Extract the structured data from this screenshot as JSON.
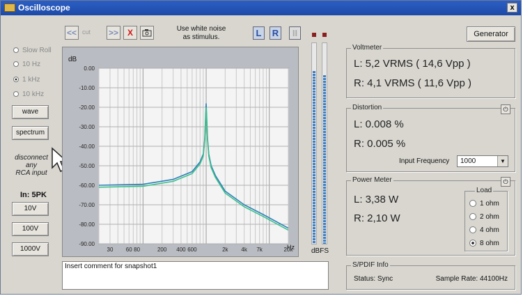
{
  "window": {
    "title": "Oscilloscope",
    "close_label": "x"
  },
  "toolbar": {
    "nav_prev": "<<",
    "nav_mid": "cut",
    "nav_next": ">>",
    "delete": "X",
    "stimulus_text_1": "Use white noise",
    "stimulus_text_2": "as stimulus.",
    "left_label": "L",
    "right_label": "R",
    "pause_label": "II",
    "generator_label": "Generator"
  },
  "left_panel": {
    "radios": [
      {
        "label": "Slow Roll",
        "selected": false
      },
      {
        "label": "10 Hz",
        "selected": false
      },
      {
        "label": "1 kHz",
        "selected": true
      },
      {
        "label": "10 kHz",
        "selected": false
      }
    ],
    "wave_label": "wave",
    "spectrum_label": "spectrum",
    "disconnect_1": "disconnect",
    "disconnect_2": "any",
    "disconnect_3": "RCA input",
    "in_label": "In: 5PK",
    "range_buttons": [
      "10V",
      "100V",
      "1000V"
    ]
  },
  "chart_data": {
    "type": "line",
    "ylabel": "dB",
    "xlabel": "Hz",
    "y_ticks": [
      "0.00",
      "-10.00",
      "-20.00",
      "-30.00",
      "-40.00",
      "-50.00",
      "-60.00",
      "-70.00",
      "-80.00",
      "-90.00"
    ],
    "x_ticks": [
      "30",
      "60",
      "80",
      "200",
      "400",
      "600",
      "2k",
      "4k",
      "7k",
      "20k"
    ],
    "ylim": [
      -90,
      0
    ],
    "xlim": [
      20,
      20000
    ],
    "log_x": true,
    "grid": true,
    "colors": {
      "left": "#2f7fb8",
      "right": "#3cc08a"
    },
    "series": [
      {
        "color": "#2f7fb8",
        "x": [
          20,
          100,
          300,
          600,
          800,
          900,
          950,
          1000,
          1050,
          1100,
          1200,
          1400,
          2000,
          4000,
          8000,
          20000
        ],
        "y": [
          -60,
          -59.5,
          -57,
          -53,
          -48,
          -44,
          -36,
          -18,
          -36,
          -44,
          -50,
          -55,
          -63,
          -70,
          -75,
          -82
        ]
      },
      {
        "color": "#3cc08a",
        "x": [
          20,
          100,
          300,
          600,
          800,
          900,
          950,
          1000,
          1050,
          1100,
          1200,
          1400,
          2000,
          4000,
          8000,
          20000
        ],
        "y": [
          -61,
          -60.5,
          -58,
          -54,
          -49,
          -45,
          -37,
          -20,
          -37,
          -45,
          -51,
          -56,
          -64,
          -71,
          -76,
          -83
        ]
      }
    ]
  },
  "meter": {
    "unit_label": "dBFS",
    "left_level": 0.86,
    "right_level": 0.84
  },
  "comment": {
    "text": "Insert comment for snapshot1"
  },
  "voltmeter": {
    "title": "Voltmeter",
    "left": "L: 5,2 VRMS ( 14,6 Vpp )",
    "right": "R: 4,1 VRMS ( 11,6 Vpp )"
  },
  "distortion": {
    "title": "Distortion",
    "left": "L: 0.008 %",
    "right": "R: 0.005 %",
    "input_freq_label": "Input Frequency",
    "input_freq_value": "1000"
  },
  "power_meter": {
    "title": "Power Meter",
    "left": "L: 3,38 W",
    "right": "R: 2,10 W",
    "load_title": "Load",
    "loads": [
      {
        "label": "1 ohm",
        "selected": false
      },
      {
        "label": "2 ohm",
        "selected": false
      },
      {
        "label": "4 ohm",
        "selected": false
      },
      {
        "label": "8 ohm",
        "selected": true
      }
    ]
  },
  "spdif": {
    "title": "S/PDIF Info",
    "status": "Status: Sync",
    "sample_rate": "Sample Rate: 44100Hz"
  }
}
